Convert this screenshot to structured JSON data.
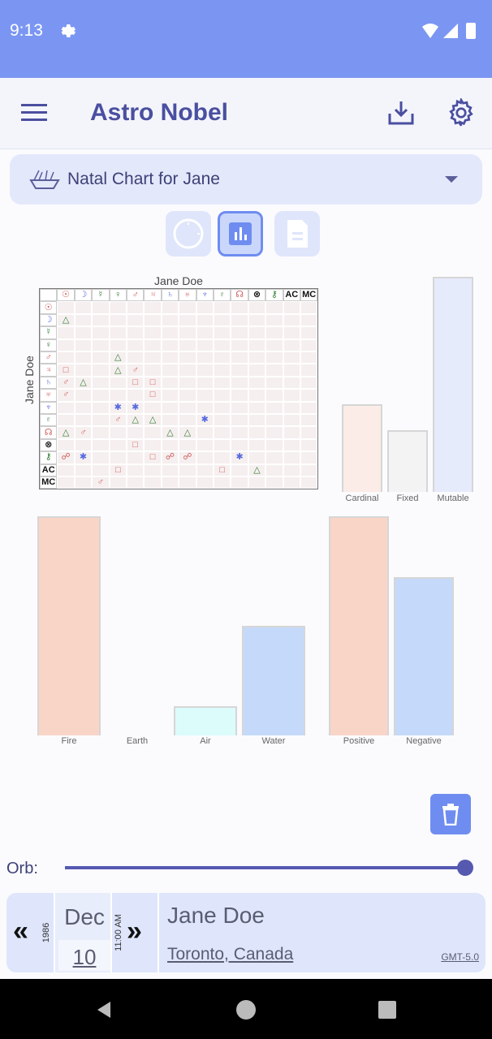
{
  "status": {
    "time": "9:13",
    "gear_icon": "gear-icon",
    "wifi_icon": "wifi-icon",
    "cell_icon": "cell-signal-icon",
    "battery_icon": "battery-icon"
  },
  "appbar": {
    "title": "Astro Nobel",
    "menu_icon": "menu-icon",
    "download_icon": "download-icon",
    "settings_icon": "settings-icon"
  },
  "chart_selector": {
    "label": "Natal Chart for Jane",
    "icon": "bowl-icon"
  },
  "view_buttons": [
    {
      "icon": "wheel-icon",
      "selected": false
    },
    {
      "icon": "bar-chart-icon",
      "selected": true
    },
    {
      "icon": "document-icon",
      "selected": false
    }
  ],
  "aspect_grid": {
    "title": "Jane Doe",
    "ylabel": "Jane Doe",
    "colors": {
      "hard": "#d05a5a",
      "soft": "#2e7d32",
      "sextile": "#5569e0",
      "neutral": "#111"
    },
    "columns": [
      "☉",
      "☽",
      "☿",
      "♀",
      "♂",
      "♃",
      "♄",
      "♅",
      "♆",
      "♇",
      "☊",
      "⊗",
      "⚷",
      "AC",
      "MC"
    ],
    "rows": [
      {
        "sym": "☉",
        "c": "#d05a5a",
        "cells": [
          "",
          "",
          "",
          "",
          "",
          "",
          "",
          "",
          "",
          "",
          "",
          "",
          "",
          "",
          ""
        ]
      },
      {
        "sym": "☽",
        "c": "#5569e0",
        "cells": [
          "△",
          "",
          "",
          "",
          "",
          "",
          "",
          "",
          "",
          "",
          "",
          "",
          "",
          "",
          ""
        ]
      },
      {
        "sym": "☿",
        "c": "#2e7d32",
        "cells": [
          "",
          "",
          "",
          "",
          "",
          "",
          "",
          "",
          "",
          "",
          "",
          "",
          "",
          "",
          ""
        ]
      },
      {
        "sym": "♀",
        "c": "#2e7d32",
        "cells": [
          "",
          "",
          "",
          "",
          "",
          "",
          "",
          "",
          "",
          "",
          "",
          "",
          "",
          "",
          ""
        ]
      },
      {
        "sym": "♂",
        "c": "#d05a5a",
        "cells": [
          "",
          "",
          "",
          "△",
          "",
          "",
          "",
          "",
          "",
          "",
          "",
          "",
          "",
          "",
          ""
        ]
      },
      {
        "sym": "♃",
        "c": "#d05a5a",
        "cells": [
          "□",
          "",
          "",
          "△",
          "♂",
          "",
          "",
          "",
          "",
          "",
          "",
          "",
          "",
          "",
          ""
        ]
      },
      {
        "sym": "♄",
        "c": "#5569e0",
        "cells": [
          "♂",
          "△",
          "",
          "",
          "□",
          "□",
          "",
          "",
          "",
          "",
          "",
          "",
          "",
          "",
          ""
        ]
      },
      {
        "sym": "♅",
        "c": "#d05a5a",
        "cells": [
          "♂",
          "",
          "",
          "",
          "",
          "□",
          "",
          "",
          "",
          "",
          "",
          "",
          "",
          "",
          ""
        ]
      },
      {
        "sym": "♆",
        "c": "#5569e0",
        "cells": [
          "",
          "",
          "",
          "✱",
          "✱",
          "",
          "",
          "",
          "",
          "",
          "",
          "",
          "",
          "",
          ""
        ]
      },
      {
        "sym": "♇",
        "c": "#2e7d32",
        "cells": [
          "",
          "",
          "",
          "♂",
          "△",
          "△",
          "",
          "",
          "✱",
          "",
          "",
          "",
          "",
          "",
          ""
        ]
      },
      {
        "sym": "☊",
        "c": "#d05a5a",
        "cells": [
          "△",
          "♂",
          "",
          "",
          "",
          "",
          "△",
          "△",
          "",
          "",
          "",
          "",
          "",
          "",
          ""
        ]
      },
      {
        "sym": "⊗",
        "c": "#111",
        "cells": [
          "",
          "",
          "",
          "",
          "□",
          "",
          "",
          "",
          "",
          "",
          "",
          "",
          "",
          "",
          ""
        ]
      },
      {
        "sym": "⚷",
        "c": "#2e7d32",
        "cells": [
          "☍",
          "✱",
          "",
          "",
          "",
          "□",
          "☍",
          "☍",
          "",
          "",
          "✱",
          "",
          "",
          "",
          ""
        ]
      },
      {
        "sym": "AC",
        "c": "#111",
        "cells": [
          "",
          "",
          "",
          "□",
          "",
          "",
          "",
          "",
          "",
          "□",
          "",
          "△",
          "",
          "",
          ""
        ]
      },
      {
        "sym": "MC",
        "c": "#111",
        "cells": [
          "",
          "",
          "♂",
          "",
          "",
          "",
          "",
          "",
          "",
          "",
          "",
          "",
          "",
          "",
          ""
        ]
      }
    ]
  },
  "chart_data": [
    {
      "type": "bar",
      "categories": [
        "Cardinal",
        "Fixed",
        "Mutable"
      ],
      "values": [
        4,
        2.8,
        9.8
      ],
      "colors": [
        "#fbece8",
        "#f3f3f3",
        "#e5ebfb"
      ],
      "ylim": [
        0,
        10
      ]
    },
    {
      "type": "bar",
      "categories": [
        "Fire",
        "Earth",
        "Air",
        "Water"
      ],
      "values": [
        9,
        0,
        1.2,
        4.5
      ],
      "colors": [
        "#f9d5c8",
        "#f3f3f3",
        "#dcfbfb",
        "#c5dafa"
      ],
      "ylim": [
        0,
        9
      ]
    },
    {
      "type": "bar",
      "categories": [
        "Positive",
        "Negative"
      ],
      "values": [
        9,
        6.5
      ],
      "colors": [
        "#f9d5c8",
        "#c5dafa"
      ],
      "ylim": [
        0,
        9
      ]
    }
  ],
  "controls": {
    "trash_icon": "trash-icon",
    "orb_label": "Orb:",
    "orb_value": 1.0
  },
  "bottom": {
    "prev_label": "«",
    "year": "1986",
    "month": "Dec",
    "day": "10",
    "time": "11:00 AM",
    "next_label": "»",
    "name": "Jane Doe",
    "place": "Toronto, Canada",
    "tz": "GMT-5.0"
  }
}
